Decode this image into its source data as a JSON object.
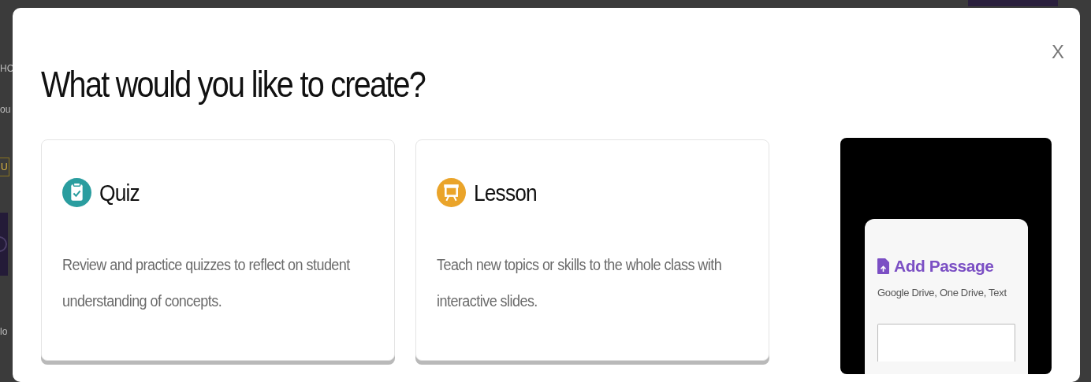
{
  "background": {
    "fragments": [
      {
        "kind": "text",
        "text": "HC"
      },
      {
        "kind": "text",
        "text": "ou"
      },
      {
        "kind": "button",
        "text": "U"
      },
      {
        "kind": "panel"
      },
      {
        "kind": "text",
        "text": "lo"
      }
    ]
  },
  "modal": {
    "title": "What would you like to create?",
    "close": "X",
    "options": [
      {
        "kind": "quiz",
        "title": "Quiz",
        "color": "#2a9d9f",
        "description": "Review and practice quizzes to reflect on student understanding of concepts."
      },
      {
        "kind": "lesson",
        "title": "Lesson",
        "color": "#eaa42a",
        "description": "Teach new topics or skills to the whole class with interactive slides."
      }
    ],
    "preview": {
      "title": "Add Passage",
      "subtitle": "Google Drive, One Drive, Text"
    }
  }
}
